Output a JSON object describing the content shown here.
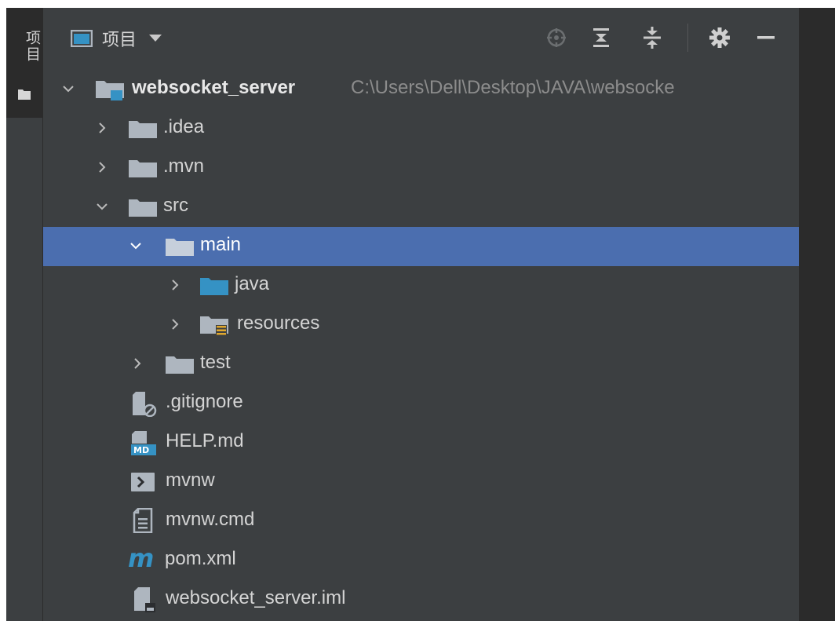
{
  "sidebar": {
    "tab_label": "项目"
  },
  "header": {
    "title": "项目"
  },
  "tree": {
    "root": {
      "name": "websocket_server",
      "path": "C:\\Users\\Dell\\Desktop\\JAVA\\websocke"
    },
    "items": [
      {
        "label": ".idea"
      },
      {
        "label": ".mvn"
      },
      {
        "label": "src"
      },
      {
        "label": "main"
      },
      {
        "label": "java"
      },
      {
        "label": "resources"
      },
      {
        "label": "test"
      },
      {
        "label": ".gitignore"
      },
      {
        "label": "HELP.md"
      },
      {
        "label": "mvnw"
      },
      {
        "label": "mvnw.cmd"
      },
      {
        "label": "pom.xml"
      },
      {
        "label": "websocket_server.iml"
      }
    ]
  },
  "colors": {
    "panel_bg": "#3c3f41",
    "selection": "#4b6eaf",
    "folder": "#aeb6bf",
    "source_folder": "#3592c4",
    "maven": "#3592c4"
  },
  "icons": {
    "header": [
      "window-icon",
      "chevron-down-icon",
      "locate-icon",
      "expand-all-icon",
      "collapse-all-icon",
      "gear-icon",
      "minimize-icon"
    ],
    "files": {
      ".gitignore": "ignore-file-icon",
      "HELP.md": "markdown-file-icon",
      "mvnw": "shell-script-icon",
      "mvnw.cmd": "text-file-icon",
      "pom.xml": "maven-icon",
      "websocket_server.iml": "module-file-icon"
    }
  }
}
